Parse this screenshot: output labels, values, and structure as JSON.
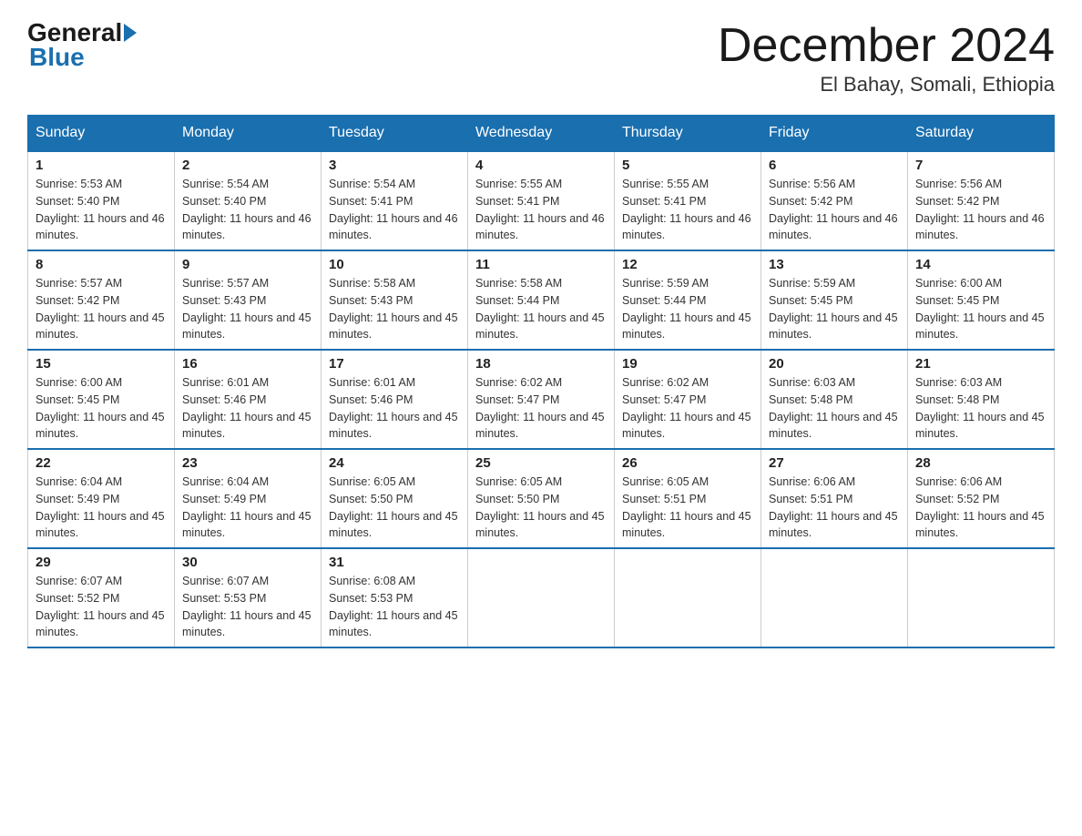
{
  "header": {
    "logo_general": "General",
    "logo_blue": "Blue",
    "month_title": "December 2024",
    "location": "El Bahay, Somali, Ethiopia"
  },
  "days_of_week": [
    "Sunday",
    "Monday",
    "Tuesday",
    "Wednesday",
    "Thursday",
    "Friday",
    "Saturday"
  ],
  "weeks": [
    [
      {
        "day": "1",
        "sunrise": "5:53 AM",
        "sunset": "5:40 PM",
        "daylight": "11 hours and 46 minutes."
      },
      {
        "day": "2",
        "sunrise": "5:54 AM",
        "sunset": "5:40 PM",
        "daylight": "11 hours and 46 minutes."
      },
      {
        "day": "3",
        "sunrise": "5:54 AM",
        "sunset": "5:41 PM",
        "daylight": "11 hours and 46 minutes."
      },
      {
        "day": "4",
        "sunrise": "5:55 AM",
        "sunset": "5:41 PM",
        "daylight": "11 hours and 46 minutes."
      },
      {
        "day": "5",
        "sunrise": "5:55 AM",
        "sunset": "5:41 PM",
        "daylight": "11 hours and 46 minutes."
      },
      {
        "day": "6",
        "sunrise": "5:56 AM",
        "sunset": "5:42 PM",
        "daylight": "11 hours and 46 minutes."
      },
      {
        "day": "7",
        "sunrise": "5:56 AM",
        "sunset": "5:42 PM",
        "daylight": "11 hours and 46 minutes."
      }
    ],
    [
      {
        "day": "8",
        "sunrise": "5:57 AM",
        "sunset": "5:42 PM",
        "daylight": "11 hours and 45 minutes."
      },
      {
        "day": "9",
        "sunrise": "5:57 AM",
        "sunset": "5:43 PM",
        "daylight": "11 hours and 45 minutes."
      },
      {
        "day": "10",
        "sunrise": "5:58 AM",
        "sunset": "5:43 PM",
        "daylight": "11 hours and 45 minutes."
      },
      {
        "day": "11",
        "sunrise": "5:58 AM",
        "sunset": "5:44 PM",
        "daylight": "11 hours and 45 minutes."
      },
      {
        "day": "12",
        "sunrise": "5:59 AM",
        "sunset": "5:44 PM",
        "daylight": "11 hours and 45 minutes."
      },
      {
        "day": "13",
        "sunrise": "5:59 AM",
        "sunset": "5:45 PM",
        "daylight": "11 hours and 45 minutes."
      },
      {
        "day": "14",
        "sunrise": "6:00 AM",
        "sunset": "5:45 PM",
        "daylight": "11 hours and 45 minutes."
      }
    ],
    [
      {
        "day": "15",
        "sunrise": "6:00 AM",
        "sunset": "5:45 PM",
        "daylight": "11 hours and 45 minutes."
      },
      {
        "day": "16",
        "sunrise": "6:01 AM",
        "sunset": "5:46 PM",
        "daylight": "11 hours and 45 minutes."
      },
      {
        "day": "17",
        "sunrise": "6:01 AM",
        "sunset": "5:46 PM",
        "daylight": "11 hours and 45 minutes."
      },
      {
        "day": "18",
        "sunrise": "6:02 AM",
        "sunset": "5:47 PM",
        "daylight": "11 hours and 45 minutes."
      },
      {
        "day": "19",
        "sunrise": "6:02 AM",
        "sunset": "5:47 PM",
        "daylight": "11 hours and 45 minutes."
      },
      {
        "day": "20",
        "sunrise": "6:03 AM",
        "sunset": "5:48 PM",
        "daylight": "11 hours and 45 minutes."
      },
      {
        "day": "21",
        "sunrise": "6:03 AM",
        "sunset": "5:48 PM",
        "daylight": "11 hours and 45 minutes."
      }
    ],
    [
      {
        "day": "22",
        "sunrise": "6:04 AM",
        "sunset": "5:49 PM",
        "daylight": "11 hours and 45 minutes."
      },
      {
        "day": "23",
        "sunrise": "6:04 AM",
        "sunset": "5:49 PM",
        "daylight": "11 hours and 45 minutes."
      },
      {
        "day": "24",
        "sunrise": "6:05 AM",
        "sunset": "5:50 PM",
        "daylight": "11 hours and 45 minutes."
      },
      {
        "day": "25",
        "sunrise": "6:05 AM",
        "sunset": "5:50 PM",
        "daylight": "11 hours and 45 minutes."
      },
      {
        "day": "26",
        "sunrise": "6:05 AM",
        "sunset": "5:51 PM",
        "daylight": "11 hours and 45 minutes."
      },
      {
        "day": "27",
        "sunrise": "6:06 AM",
        "sunset": "5:51 PM",
        "daylight": "11 hours and 45 minutes."
      },
      {
        "day": "28",
        "sunrise": "6:06 AM",
        "sunset": "5:52 PM",
        "daylight": "11 hours and 45 minutes."
      }
    ],
    [
      {
        "day": "29",
        "sunrise": "6:07 AM",
        "sunset": "5:52 PM",
        "daylight": "11 hours and 45 minutes."
      },
      {
        "day": "30",
        "sunrise": "6:07 AM",
        "sunset": "5:53 PM",
        "daylight": "11 hours and 45 minutes."
      },
      {
        "day": "31",
        "sunrise": "6:08 AM",
        "sunset": "5:53 PM",
        "daylight": "11 hours and 45 minutes."
      },
      null,
      null,
      null,
      null
    ]
  ]
}
